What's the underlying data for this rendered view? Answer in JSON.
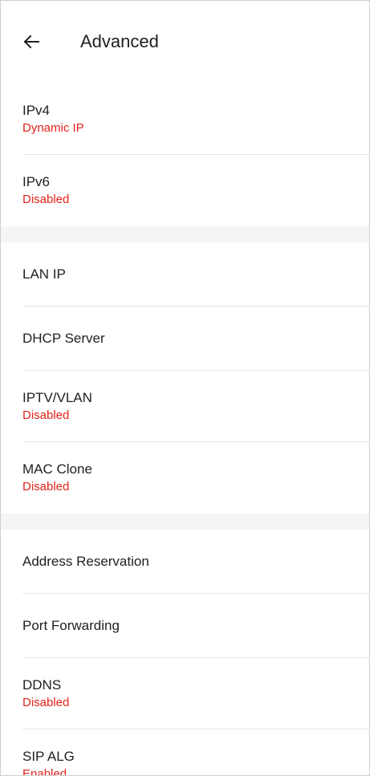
{
  "header": {
    "back_icon": "arrow-left-icon",
    "title": "Advanced"
  },
  "colors": {
    "status_red": "#e2231a",
    "section_gap": "#f5f5f5"
  },
  "groups": [
    {
      "items": [
        {
          "label": "IPv4",
          "status": "Dynamic IP"
        },
        {
          "label": "IPv6",
          "status": "Disabled"
        }
      ]
    },
    {
      "items": [
        {
          "label": "LAN IP"
        },
        {
          "label": "DHCP Server"
        },
        {
          "label": "IPTV/VLAN",
          "status": "Disabled"
        },
        {
          "label": "MAC Clone",
          "status": "Disabled"
        }
      ]
    },
    {
      "items": [
        {
          "label": "Address Reservation"
        },
        {
          "label": "Port Forwarding"
        },
        {
          "label": "DDNS",
          "status": "Disabled"
        },
        {
          "label": "SIP ALG",
          "status": "Enabled"
        }
      ]
    }
  ]
}
